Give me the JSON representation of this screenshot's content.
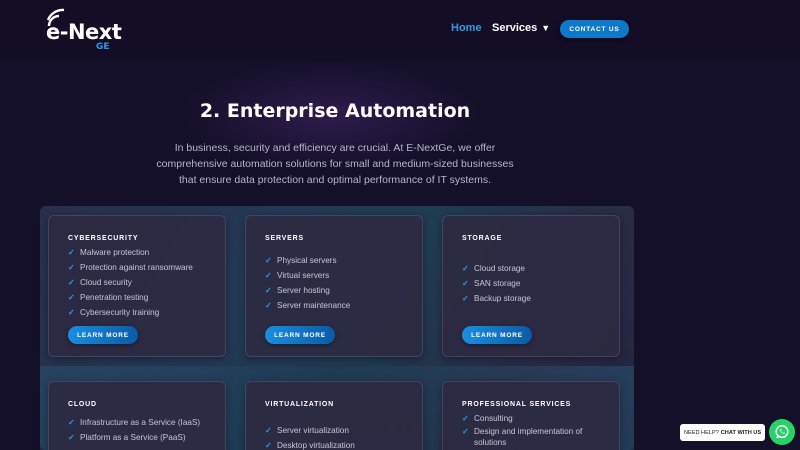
{
  "header": {
    "logo_text": "e-Next",
    "logo_sub": "GE",
    "nav": {
      "home": "Home",
      "services": "Services"
    },
    "contact_label": "CONTACT US"
  },
  "hero": {
    "title": "2. Enterprise Automation",
    "description": "In business, security and efficiency are crucial. At E-NextGe, we offer comprehensive automation solutions for small and medium-sized businesses that ensure data protection and optimal performance of IT systems."
  },
  "cards": [
    {
      "title": "CYBERSECURITY",
      "items": [
        "Malware protection",
        "Protection against ransomware",
        "Cloud security",
        "Penetration testing",
        "Cybersecurity training"
      ],
      "button": "LEARN MORE"
    },
    {
      "title": "SERVERS",
      "items": [
        "Physical servers",
        "Virtual servers",
        "Server hosting",
        "Server maintenance"
      ],
      "button": "LEARN MORE"
    },
    {
      "title": "STORAGE",
      "items": [
        "Cloud storage",
        "SAN storage",
        "Backup storage"
      ],
      "button": "LEARN MORE"
    },
    {
      "title": "CLOUD",
      "items": [
        "Infrastructure as a Service (IaaS)",
        "Platform as a Service (PaaS)"
      ]
    },
    {
      "title": "VIRTUALIZATION",
      "items": [
        "Server virtualization",
        "Desktop virtualization"
      ]
    },
    {
      "title": "PROFESSIONAL SERVICES",
      "items": [
        "Consulting",
        "Design and implementation of solutions"
      ]
    }
  ],
  "whatsapp": {
    "prefix": "NEED HELP?",
    "cta": "CHAT WITH US"
  },
  "colors": {
    "accent": "#2f9be8",
    "background": "#14102a",
    "whatsapp": "#25d366"
  }
}
